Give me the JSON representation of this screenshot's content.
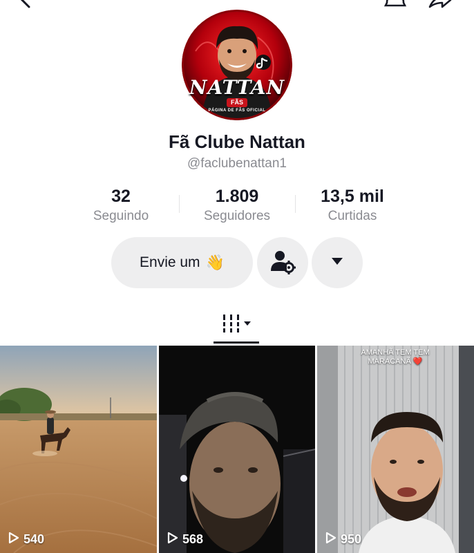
{
  "profile": {
    "avatar": {
      "logo_text": "NATTAN",
      "badge_text": "FÃS",
      "ring_text": "PÁGINA DE FÃS OFICIAL"
    },
    "name": "Fã Clube Nattan",
    "handle": "@faclubenattan1"
  },
  "stats": [
    {
      "value": "32",
      "label": "Seguindo"
    },
    {
      "value": "1.809",
      "label": "Seguidores"
    },
    {
      "value": "13,5 mil",
      "label": "Curtidas"
    }
  ],
  "actions": {
    "message_label": "Envie um",
    "wave_emoji": "👋",
    "follow_settings_icon": "user-gear-icon",
    "more_icon": "caret-down-icon"
  },
  "tabs": {
    "grid_icon": "grid-columns-icon"
  },
  "videos": [
    {
      "views": "540",
      "caption": ""
    },
    {
      "views": "568",
      "caption": ""
    },
    {
      "views": "950",
      "caption_line1": "AMANHÃ TEM TEM",
      "caption_line2": "MARACANÃ ❤️"
    }
  ],
  "colors": {
    "text": "#161823",
    "muted": "#8a8b91",
    "button_bg": "#eeeeef",
    "avatar_red": "#c8141c"
  }
}
